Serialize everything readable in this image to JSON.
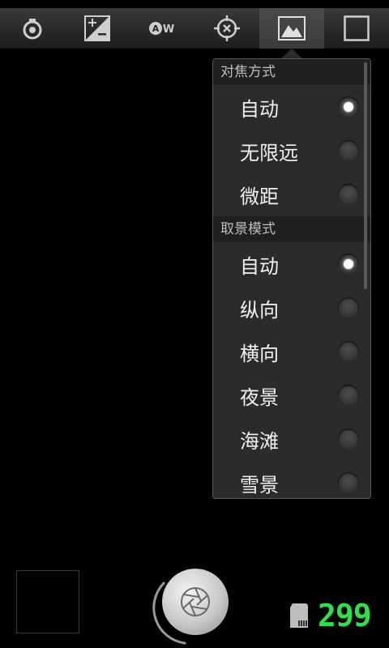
{
  "toolbar": {
    "icons": [
      "flash-icon",
      "exposure-icon",
      "white-balance-icon",
      "focus-icon",
      "scene-mode-icon",
      "frame-icon"
    ],
    "active_index": 4
  },
  "menu": {
    "focus_section": {
      "title": "对焦方式",
      "items": [
        {
          "label": "自动",
          "selected": true
        },
        {
          "label": "无限远",
          "selected": false
        },
        {
          "label": "微距",
          "selected": false
        }
      ]
    },
    "scene_section": {
      "title": "取景模式",
      "items": [
        {
          "label": "自动",
          "selected": true
        },
        {
          "label": "纵向",
          "selected": false
        },
        {
          "label": "横向",
          "selected": false
        },
        {
          "label": "夜景",
          "selected": false
        },
        {
          "label": "海滩",
          "selected": false
        },
        {
          "label": "雪景",
          "selected": false
        }
      ]
    }
  },
  "storage": {
    "remaining_shots": "299"
  },
  "colors": {
    "counter": "#2ee04d",
    "toolbar_bg": "#2a2a2a",
    "menu_bg": "#2b2b2b"
  }
}
